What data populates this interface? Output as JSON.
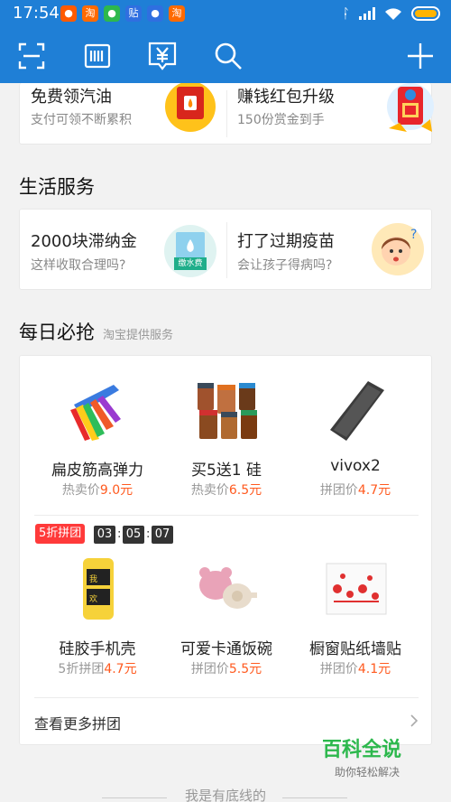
{
  "status_bar": {
    "time": "17:54",
    "app_badges": [
      "淘",
      "淘",
      "贴",
      "淘"
    ]
  },
  "toolbar": {
    "icons": [
      "scan-icon",
      "barcode-icon",
      "payment-code-icon",
      "search-icon",
      "plus-icon"
    ]
  },
  "top_promos": [
    {
      "title": "免费领汽油",
      "subtitle": "支付可领不断累积"
    },
    {
      "title": "赚钱红包升级",
      "subtitle": "150份赏金到手"
    }
  ],
  "life_services": {
    "title": "生活服务",
    "items": [
      {
        "title": "2000块滞纳金",
        "subtitle": "这样收取合理吗?",
        "icon_label": "缴水费"
      },
      {
        "title": "打了过期疫苗",
        "subtitle": "会让孩子得病吗?"
      }
    ]
  },
  "daily": {
    "title": "每日必抢",
    "note": "淘宝提供服务",
    "row1": [
      {
        "name": "扁皮筋高弹力",
        "price_label": "热卖价",
        "price": "9.0元"
      },
      {
        "name": "买5送1 硅",
        "price_label": "热卖价",
        "price": "6.5元"
      },
      {
        "name": "vivox2",
        "price_label": "拼团价",
        "price": "4.7元"
      }
    ],
    "group_badge": "5折拼团",
    "countdown": {
      "h": "03",
      "m": "05",
      "s": "07",
      "sep": ":"
    },
    "row2": [
      {
        "name": "硅胶手机壳",
        "price_label": "5折拼团",
        "price": "4.7元"
      },
      {
        "name": "可爱卡通饭碗",
        "price_label": "拼团价",
        "price": "5.5元"
      },
      {
        "name": "橱窗贴纸墙贴",
        "price_label": "拼团价",
        "price": "4.1元"
      }
    ],
    "more_link": "查看更多拼团"
  },
  "footer_text": "我是有底线的",
  "watermark": {
    "title": "百科全说",
    "subtitle": "助你轻松解决"
  },
  "colors": {
    "brand": "#1f7fd6",
    "price": "#ff5a1f",
    "badge": "#ff3a3a"
  }
}
